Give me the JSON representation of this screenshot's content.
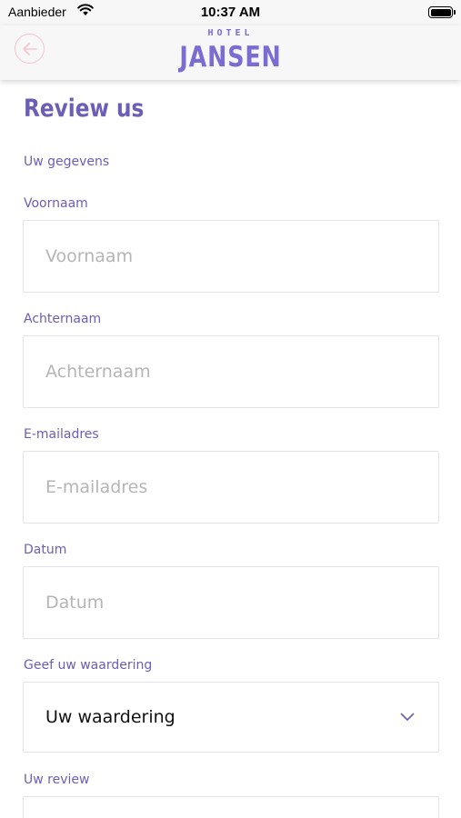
{
  "status_bar": {
    "carrier": "Aanbieder",
    "time": "10:37 AM"
  },
  "header": {
    "brand_small": "HOTEL",
    "brand_big": "JANSEN"
  },
  "page": {
    "title": "Review us",
    "section_label": "Uw gegevens"
  },
  "form": {
    "first_name": {
      "label": "Voornaam",
      "placeholder": "Voornaam"
    },
    "last_name": {
      "label": "Achternaam",
      "placeholder": "Achternaam"
    },
    "email": {
      "label": "E-mailadres",
      "placeholder": "E-mailadres"
    },
    "date": {
      "label": "Datum",
      "placeholder": "Datum"
    },
    "rating": {
      "label": "Geef uw waardering",
      "value": "Uw waardering"
    },
    "review": {
      "label": "Uw review"
    }
  },
  "colors": {
    "accent": "#6b5fb5",
    "brand": "#7b6cd1",
    "back_button": "#f4c5cc"
  }
}
